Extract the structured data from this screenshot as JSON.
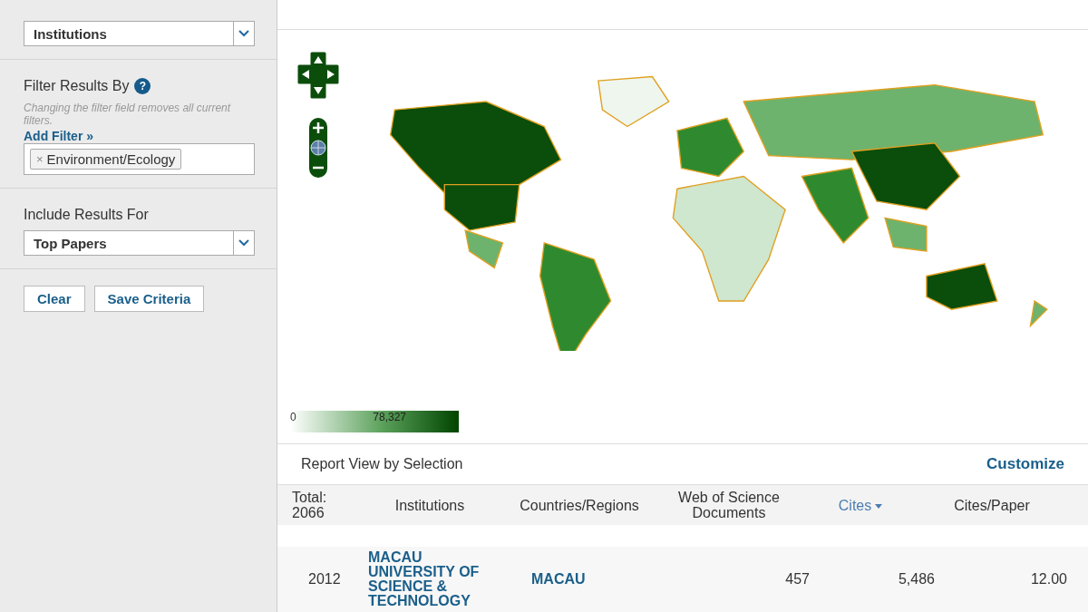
{
  "sidebar": {
    "results_list": {
      "value": "Institutions"
    },
    "filter": {
      "title": "Filter Results By",
      "help": "?",
      "note": "Changing the filter field removes all current filters.",
      "add_filter": "Add Filter »",
      "tags": [
        {
          "remove": "×",
          "label": "Environment/Ecology"
        }
      ]
    },
    "include": {
      "label": "Include Results For",
      "value": "Top Papers"
    },
    "buttons": [
      "Clear",
      "Save Criteria"
    ]
  },
  "map_panel": {
    "legend": {
      "min": "0",
      "max": "78,327"
    }
  },
  "report": {
    "title": "Report View by Selection",
    "customize": "Customize",
    "columns": [
      {
        "label": "Total: 2066",
        "sorted": false
      },
      {
        "label": "Institutions",
        "sorted": false
      },
      {
        "label": "Countries/Regions",
        "sorted": false
      },
      {
        "label": "Web of Science Documents",
        "sorted": false
      },
      {
        "label": "Cites",
        "sorted": true
      },
      {
        "label": "Cites/Paper",
        "sorted": false
      }
    ],
    "rows": [
      {
        "year": "2012",
        "institution": "MACAU UNIVERSITY OF SCIENCE & TECHNOLOGY",
        "country": "MACAU",
        "documents": "457",
        "cites": "5,486",
        "cites_per_paper": "12.00"
      }
    ]
  }
}
